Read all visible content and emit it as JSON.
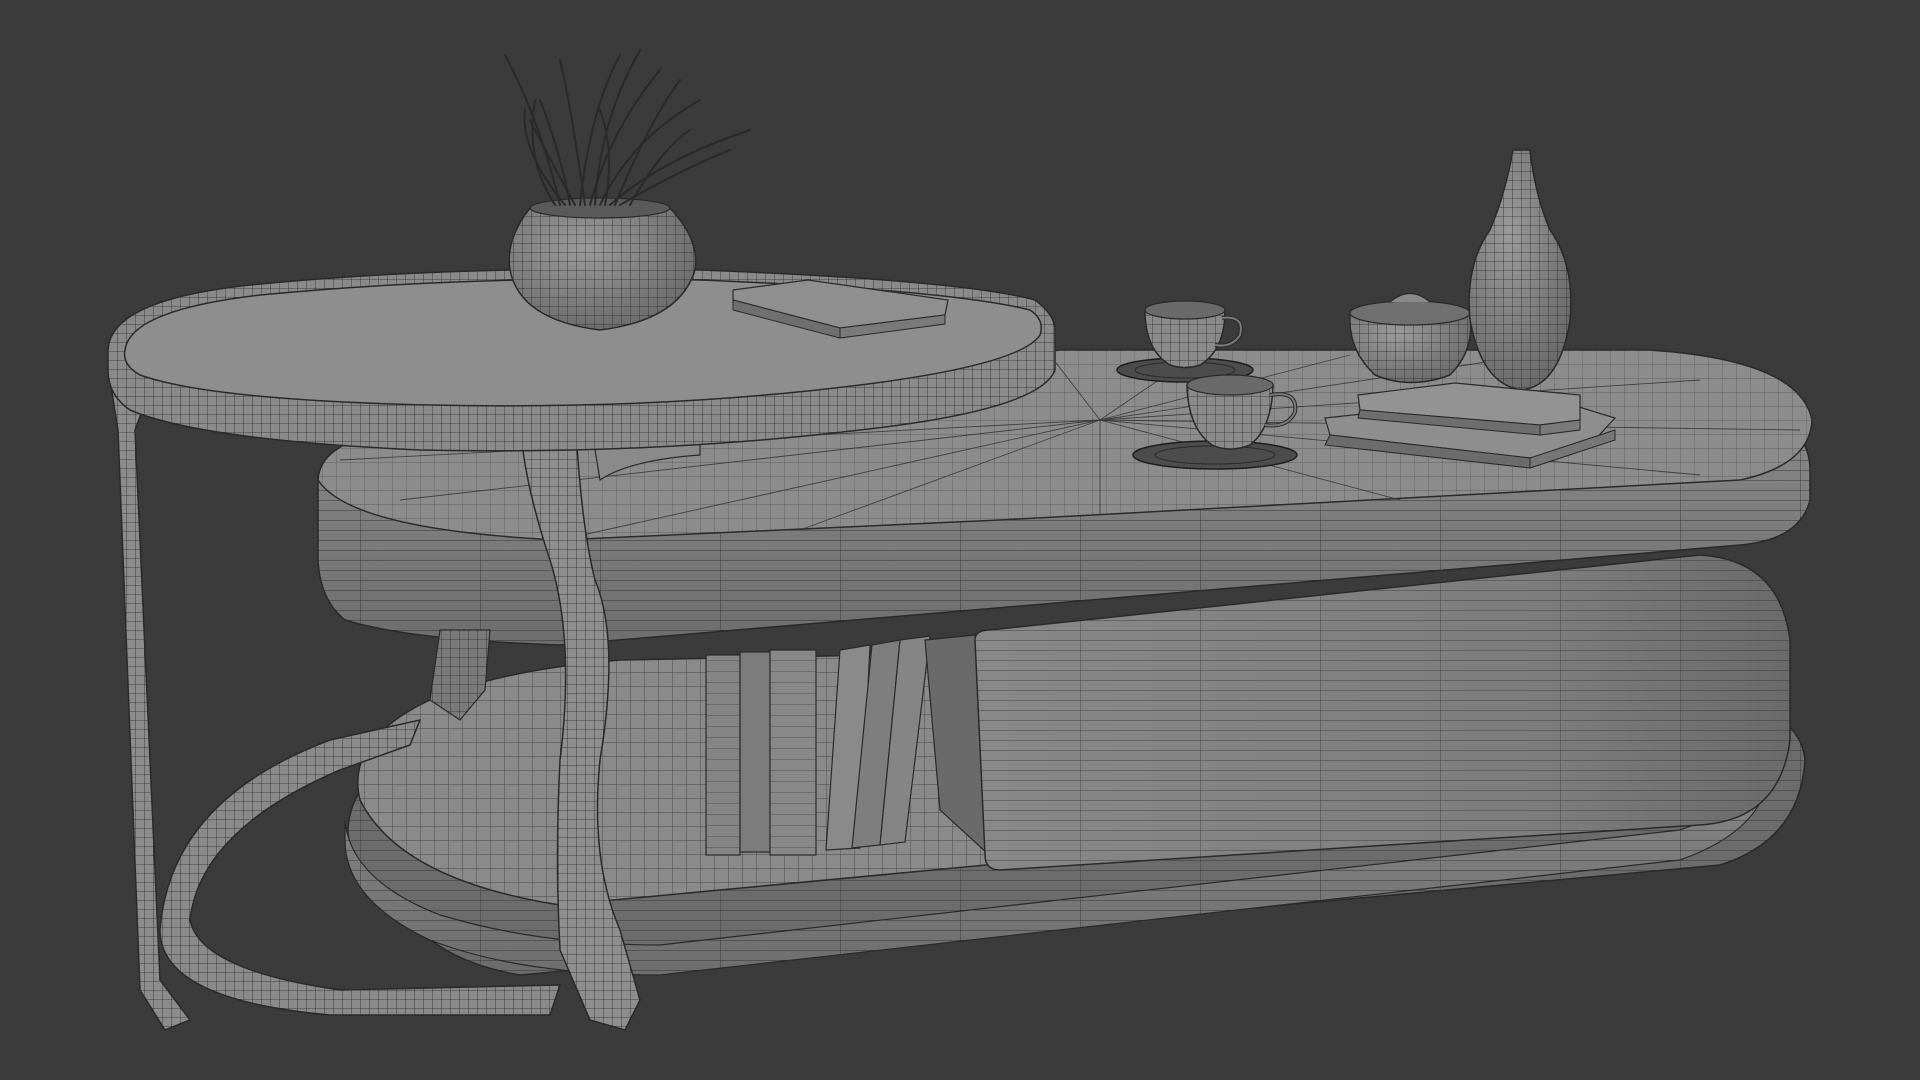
{
  "scene": {
    "background": "#3b3b3b",
    "wire_color": "#2a2a2a",
    "surface_light": "#8e8e8e",
    "surface_mid": "#7a7a7a",
    "surface_dark": "#5e5e5e",
    "objects": [
      "round-side-table",
      "oval-coffee-table",
      "plant-pot",
      "grass-plant",
      "book-on-round-table",
      "coffee-cup-1",
      "coffee-cup-2",
      "saucer-1",
      "saucer-2",
      "bottle-vase",
      "bowl-vase",
      "book-stack",
      "shelf-books",
      "drawer-box"
    ]
  }
}
